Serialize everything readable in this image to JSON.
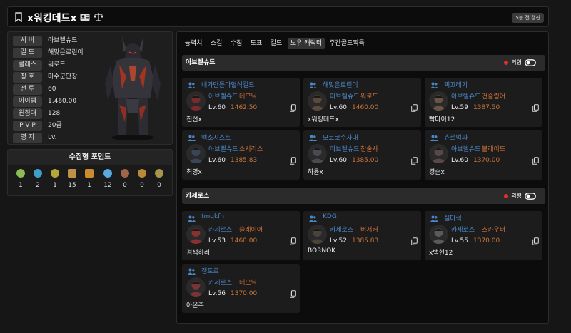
{
  "header": {
    "name": "x워킹데드x",
    "refresh_label": "5분 전 갱신"
  },
  "profile": {
    "rows": [
      {
        "label": "서 버",
        "value": "아브렐슈드"
      },
      {
        "label": "길 드",
        "value": "해맞은로린이"
      },
      {
        "label": "클래스",
        "value": "워로드"
      },
      {
        "label": "칭 호",
        "value": "마수군단장"
      },
      {
        "label": "전 투",
        "value": "60"
      },
      {
        "label": "아이템",
        "value": "1,460.00"
      },
      {
        "label": "원정대",
        "value": "128"
      },
      {
        "label": "P V P",
        "value": "20급"
      },
      {
        "label": "영 지",
        "value": "Lv."
      }
    ]
  },
  "collection": {
    "title": "수집형 포인트",
    "items": [
      {
        "icon": "mokoko-seed-icon",
        "color": "#8dbb54",
        "value": "1"
      },
      {
        "icon": "island-heart-icon",
        "color": "#3ca0c8",
        "value": "2"
      },
      {
        "icon": "giants-heart-icon",
        "color": "#b8a53a",
        "value": "1"
      },
      {
        "icon": "art-icon",
        "color": "#c09048",
        "value": "15"
      },
      {
        "icon": "voyage-icon",
        "color": "#cc8a2e",
        "value": "1"
      },
      {
        "icon": "world-tree-leaf-icon",
        "color": "#5aa8e0",
        "value": "12"
      },
      {
        "icon": "ignea-token-icon",
        "color": "#a0644a",
        "value": "0"
      },
      {
        "icon": "orpheus-star-icon",
        "color": "#b88a3a",
        "value": "0"
      },
      {
        "icon": "omnium-star-icon",
        "color": "#a8964a",
        "value": "0"
      }
    ]
  },
  "tabs": [
    {
      "label": "능력치",
      "active": false
    },
    {
      "label": "스킬",
      "active": false
    },
    {
      "label": "수집",
      "active": false
    },
    {
      "label": "도표",
      "active": false
    },
    {
      "label": "길드",
      "active": false
    },
    {
      "label": "보유 캐릭터",
      "active": true
    },
    {
      "label": "주간골드획득",
      "active": false
    }
  ],
  "outfit_label": "외형",
  "servers": [
    {
      "name": "아브렐슈드",
      "characters": [
        {
          "name": "내가만든다혈석길드",
          "server": "아브렐슈드",
          "class": "데모닉",
          "level": "Lv.60",
          "item_level": "1462.50",
          "guild": "친선x",
          "avatar_color": "#7a2a2a"
        },
        {
          "name": "해맞은로린이",
          "server": "아브렐슈드",
          "class": "워로드",
          "level": "Lv.60",
          "item_level": "1460.00",
          "guild": "x워킹데드x",
          "avatar_color": "#5a4a3a"
        },
        {
          "name": "찌끄레기",
          "server": "아브렐슈드",
          "class": "건슬링어",
          "level": "Lv.59",
          "item_level": "1387.50",
          "guild": "빡다이12",
          "avatar_color": "#6a5448"
        },
        {
          "name": "엑소시스트",
          "server": "아브렐슈드",
          "class": "소서리스",
          "level": "Lv.60",
          "item_level": "1385.83",
          "guild": "최영x",
          "avatar_color": "#3a4658"
        },
        {
          "name": "모코코수사대",
          "server": "아브렐슈드",
          "class": "창술사",
          "level": "Lv.60",
          "item_level": "1385.00",
          "guild": "하윤x",
          "avatar_color": "#4a4a50"
        },
        {
          "name": "츄르먹짜",
          "server": "아브렐슈드",
          "class": "블레이드",
          "level": "Lv.60",
          "item_level": "1370.00",
          "guild": "경순x",
          "avatar_color": "#5a4848"
        }
      ]
    },
    {
      "name": "카제로스",
      "characters": [
        {
          "name": "tmqkfn",
          "server": "카제로스",
          "class": "슬레이어",
          "level": "Lv.53",
          "item_level": "1460.00",
          "guild": "검색하러",
          "avatar_color": "#8a3030"
        },
        {
          "name": "KDG",
          "server": "카제로스",
          "class": "버서커",
          "level": "Lv.52",
          "item_level": "1385.83",
          "guild": "BORNOK",
          "avatar_color": "#4a4438"
        },
        {
          "name": "실마석",
          "server": "카제로스",
          "class": "스카우터",
          "level": "Lv.55",
          "item_level": "1370.00",
          "guild": "x백현12",
          "avatar_color": "#5a5a58"
        },
        {
          "name": "갱토르",
          "server": "카제로스",
          "class": "데모닉",
          "level": "Lv.56",
          "item_level": "1370.00",
          "guild": "아몬주",
          "avatar_color": "#7a3434"
        }
      ]
    }
  ]
}
